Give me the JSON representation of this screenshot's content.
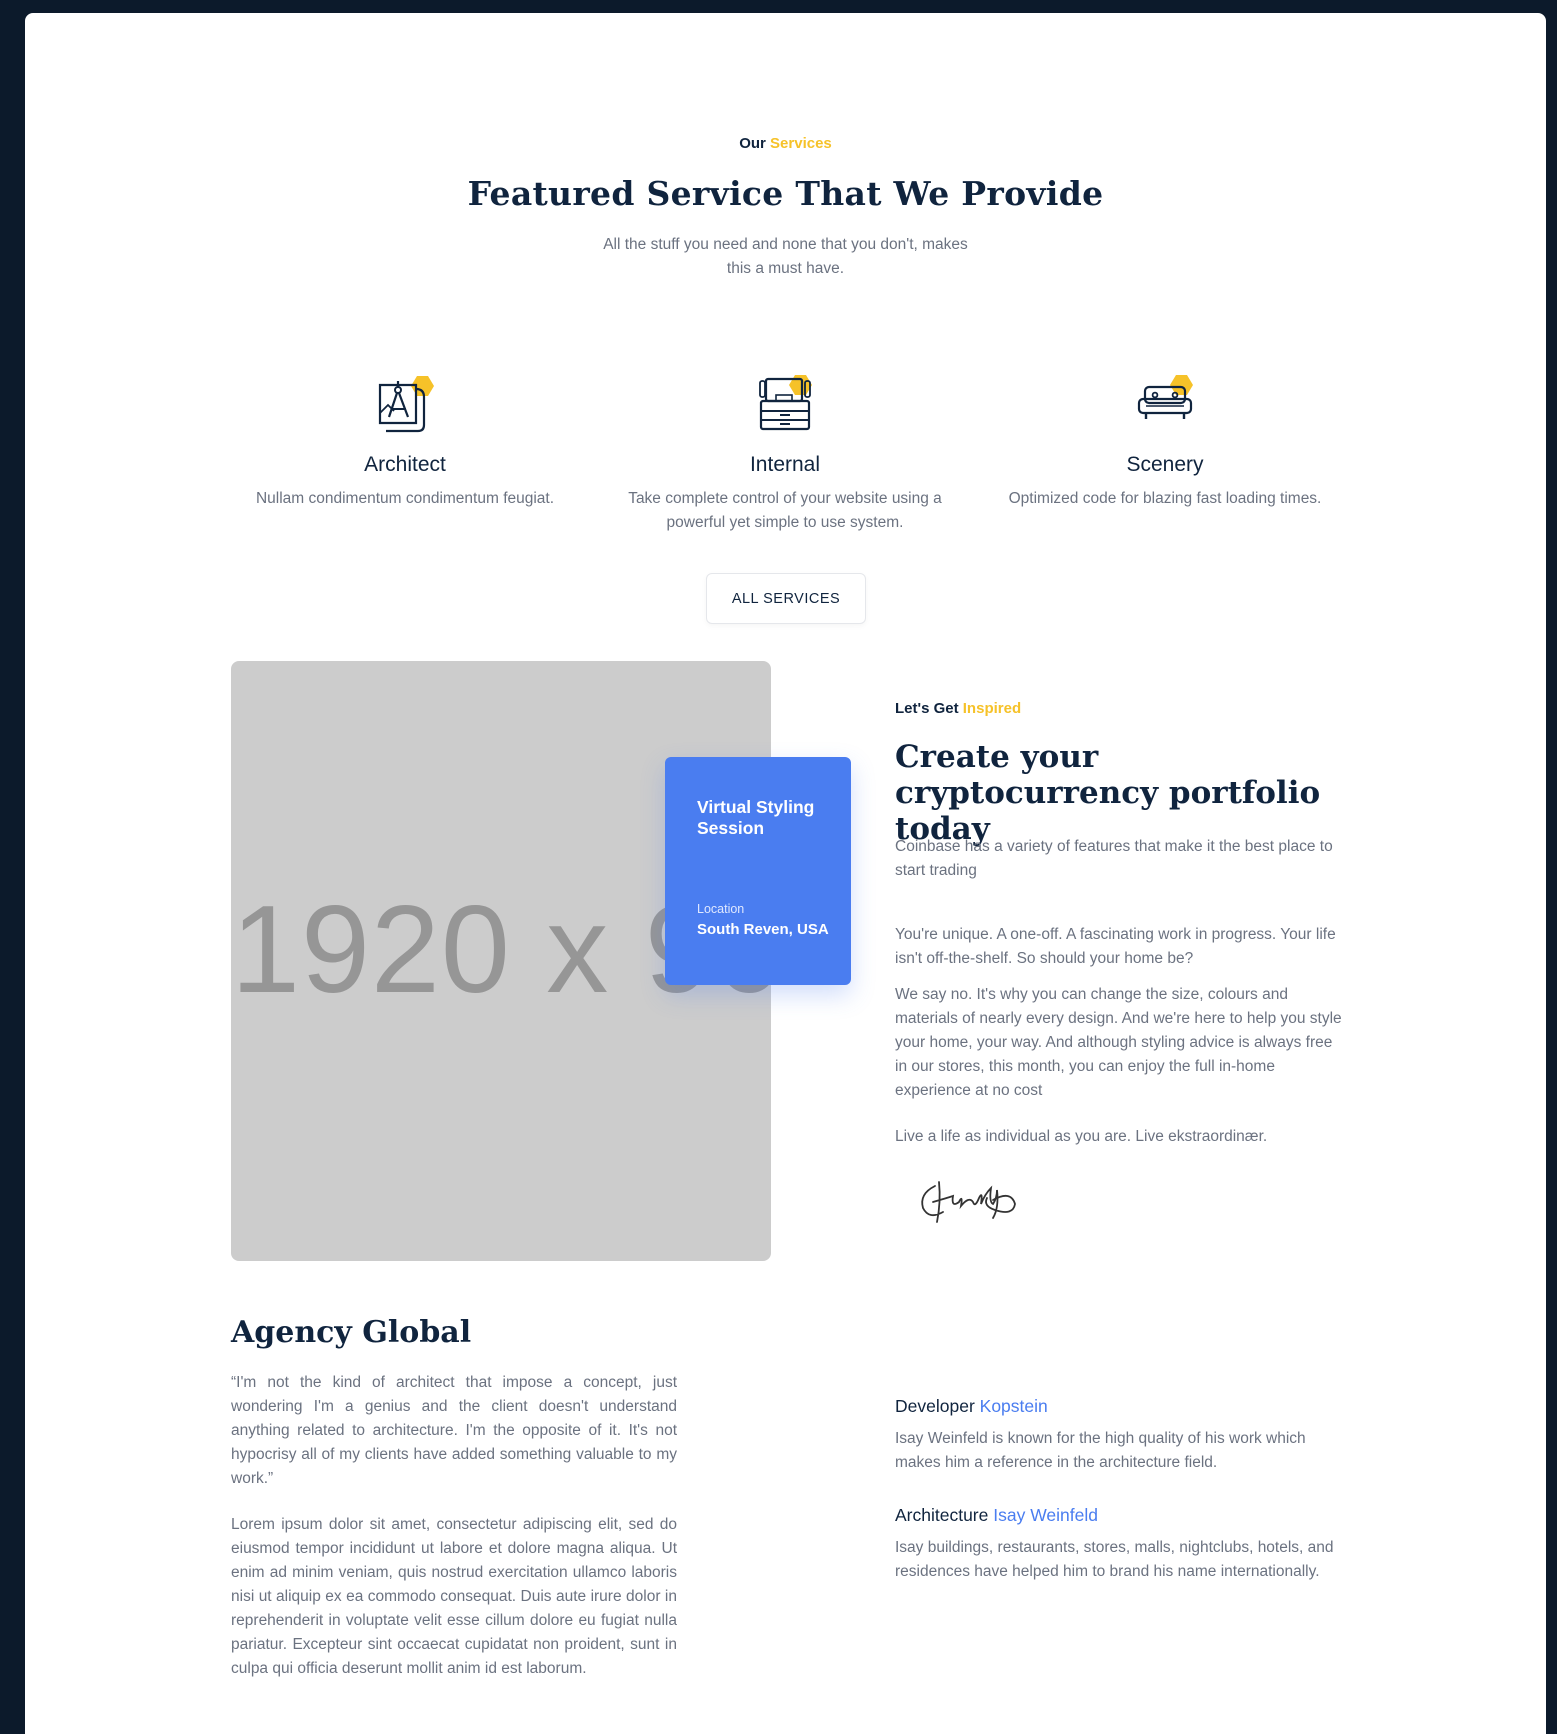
{
  "services_section": {
    "eyebrow_prefix": "Our",
    "eyebrow_highlight": "Services",
    "title": "Featured Service That We Provide",
    "lead_line1": "All the stuff you need and none that you don't, makes",
    "lead_line2": "this a must have.",
    "items": [
      {
        "icon": "architect-compass-blueprint-icon",
        "title": "Architect",
        "desc": "Nullam condimentum condimentum feugiat."
      },
      {
        "icon": "workstation-computer-icon",
        "title": "Internal",
        "desc": "Take complete control of your website using a powerful yet simple to use system."
      },
      {
        "icon": "sofa-icon",
        "title": "Scenery",
        "desc": "Optimized code for blazing fast loading times."
      }
    ],
    "button_label": "ALL SERVICES"
  },
  "feature": {
    "image_placeholder": "1920 x 900",
    "card": {
      "title": "Virtual Styling Session",
      "location_label": "Location",
      "location_value": "South Reven, USA"
    },
    "eyebrow_prefix": "Let's Get",
    "eyebrow_highlight": "Inspired",
    "title": "Create your cryptocurrency portfolio today",
    "intro": "Coinbase has a variety of features that make it the best place to start trading",
    "para1": "You're unique. A one-off. A fascinating work in progress. Your life isn't off-the-shelf. So should your home be?",
    "para2": "We say no. It's why you can change the size, colours and materials of nearly every design. And we're here to help you style your home, your way. And although styling advice is always free in our stores, this month, you can enjoy the full in-home experience at no cost",
    "para3": "Live a life as individual as you are. Live ekstraordinær.",
    "signature_text": "family"
  },
  "agency": {
    "title": "Agency Global",
    "quote": "“I'm not the kind of architect that impose a concept, just wondering I'm a genius and the client doesn't understand anything related to architecture. I'm the opposite of it. It's not hypocrisy all of my clients have added something valuable to my work.”",
    "body": "Lorem ipsum dolor sit amet, consectetur adipiscing elit, sed do eiusmod tempor incididunt ut labore et dolore magna aliqua. Ut enim ad minim veniam, quis nostrud exercitation ullamco laboris nisi ut aliquip ex ea commodo consequat. Duis aute irure dolor in reprehenderit in voluptate velit esse cillum dolore eu fugiat nulla pariatur. Excepteur sint occaecat cupidatat non proident, sunt in culpa qui officia deserunt mollit anim id est laborum.",
    "dev_label": "Developer",
    "dev_name": "Kopstein",
    "dev_desc": "Isay Weinfeld is known for the high quality of his work which makes him a reference in the architecture field.",
    "arch_label": "Architecture",
    "arch_name": "Isay Weinfeld",
    "arch_desc": "Isay buildings, restaurants, stores, malls, nightclubs, hotels, and residences have helped him to brand his name internationally."
  },
  "colors": {
    "accent_yellow": "#f6c229",
    "accent_blue": "#4a7df0",
    "heading": "#10243e",
    "frame": "#0c1a2b"
  }
}
